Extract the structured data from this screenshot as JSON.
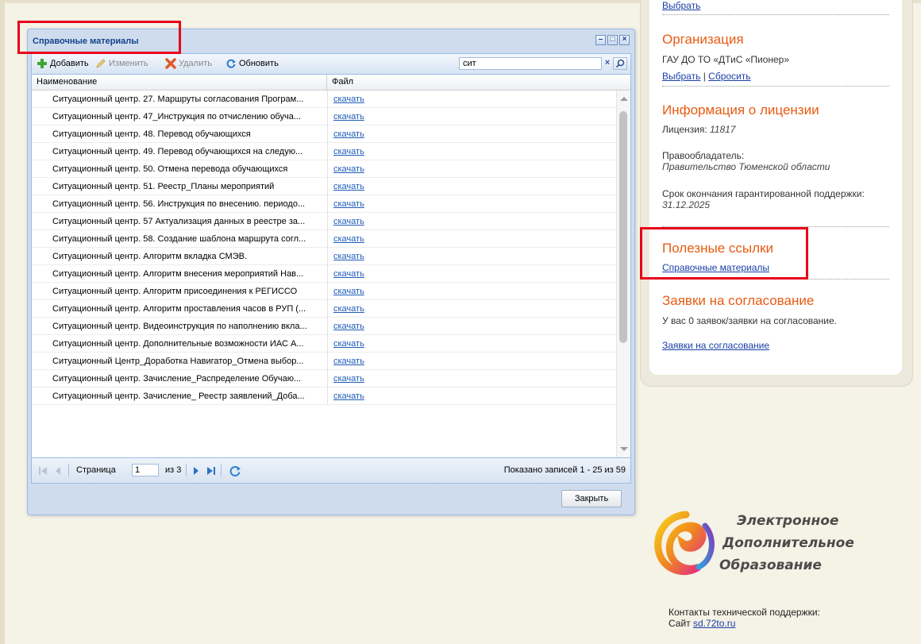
{
  "sidebar": {
    "top_link": "Выбрать",
    "organization": {
      "heading": "Организация",
      "name": "ГАУ ДО ТО «ДТиС «Пионер»",
      "choose": "Выбрать",
      "divider": "|",
      "reset": "Сбросить"
    },
    "license": {
      "heading": "Информация о лицензии",
      "number_label": "Лицензия:",
      "number": "11817",
      "holder_label": "Правообладатель:",
      "holder": "Правительство Тюменской области",
      "support_label": "Срок окончания гарантированной поддержки:",
      "support_date": "31.12.2025"
    },
    "useful": {
      "heading": "Полезные ссылки",
      "link": "Справочные материалы"
    },
    "requests": {
      "heading": "Заявки на согласование",
      "text": "У вас 0 заявок/заявки на согласование.",
      "link": "Заявки на согласование"
    }
  },
  "window": {
    "title": "Справочные материалы",
    "toolbar": {
      "add": "Добавить",
      "edit": "Изменить",
      "delete": "Удалить",
      "refresh": "Обновить",
      "search_value": "сит"
    },
    "columns": {
      "name": "Наименование",
      "file": "Файл"
    },
    "rows": [
      {
        "name": "Ситуационный центр. 27. Маршруты согласования Програм...",
        "file": "скачать"
      },
      {
        "name": "Ситуационный центр. 47_Инструкция по отчислению обуча...",
        "file": "скачать"
      },
      {
        "name": "Ситуационный центр. 48. Перевод обучающихся",
        "file": "скачать"
      },
      {
        "name": "Ситуационный центр. 49. Перевод обучающихся на следую...",
        "file": "скачать"
      },
      {
        "name": "Ситуационный центр. 50. Отмена перевода обучающихся",
        "file": "скачать"
      },
      {
        "name": "Ситуационный центр. 51. Реестр_Планы мероприятий",
        "file": "скачать"
      },
      {
        "name": "Ситуационный центр. 56. Инструкция по внесению. периодо...",
        "file": "скачать"
      },
      {
        "name": "Ситуационный центр. 57 Актуализация данных в реестре за...",
        "file": "скачать"
      },
      {
        "name": "Ситуационный центр. 58. Создание шаблона маршрута согл...",
        "file": "скачать"
      },
      {
        "name": "Ситуационный центр. Алгоритм вкладка СМЭВ.",
        "file": "скачать"
      },
      {
        "name": "Ситуационный центр. Алгоритм внесения мероприятий Нав...",
        "file": "скачать"
      },
      {
        "name": "Ситуационный центр. Алгоритм присоединения к РЕГИССО",
        "file": "скачать"
      },
      {
        "name": "Ситуационный центр. Алгоритм проставления часов в РУП (...",
        "file": "скачать"
      },
      {
        "name": "Ситуационный центр. Видеоинструкция по наполнению вкла...",
        "file": "скачать"
      },
      {
        "name": "Ситуационный центр. Дополнительные возможности ИАС А...",
        "file": "скачать"
      },
      {
        "name": "Ситуационный Центр_Доработка Навигатор_Отмена выбор...",
        "file": "скачать"
      },
      {
        "name": "Ситуационный центр. Зачисление_Распределение Обучаю...",
        "file": "скачать"
      },
      {
        "name": "Ситуационный центр. Зачисление_ Реестр заявлений_Доба...",
        "file": "скачать"
      }
    ],
    "pager": {
      "page_label": "Страница",
      "page": "1",
      "of": "из 3",
      "status": "Показано записей 1 - 25 из 59"
    },
    "close": "Закрыть"
  },
  "logo": {
    "line1": "Электронное",
    "line2": "Дополнительное",
    "line3": "Образование"
  },
  "support": {
    "line1": "Контакты технической поддержки:",
    "site_label": "Сайт",
    "site": "sd.72to.ru"
  }
}
